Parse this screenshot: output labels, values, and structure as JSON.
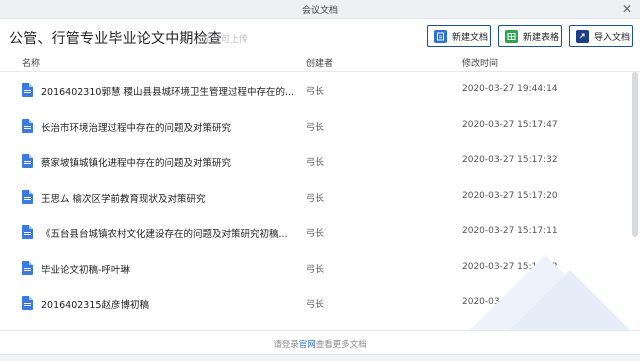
{
  "window": {
    "title": "会议文档",
    "close_glyph": "✕"
  },
  "header": {
    "title": "公管、行管专业毕业论文中期检查",
    "upload_hint": "全员可上传",
    "buttons": {
      "new_doc": "新建文档",
      "new_sheet": "新建表格",
      "import_doc": "导入文档"
    }
  },
  "columns": {
    "name": "名称",
    "creator": "创建者",
    "modified": "修改时间"
  },
  "files": [
    {
      "name": "2016402310郭慧 稷山县县城环境卫生管理过程中存在的...",
      "creator": "弓长",
      "modified": "2020-03-27 19:44:14",
      "icon": "doc-icon"
    },
    {
      "name": "长治市环境治理过程中存在的问题及对策研究",
      "creator": "弓长",
      "modified": "2020-03-27 15:17:47",
      "icon": "doc-icon"
    },
    {
      "name": "蔡家坡镇城镇化进程中存在的问题及对策研究",
      "creator": "弓长",
      "modified": "2020-03-27 15:17:32",
      "icon": "doc-icon"
    },
    {
      "name": "王思ム 榆次区学前教育现状及对策研究",
      "creator": "弓长",
      "modified": "2020-03-27 15:17:20",
      "icon": "doc-icon"
    },
    {
      "name": "《五台县台城镇农村文化建设存在的问题及对策研究初稿...",
      "creator": "弓长",
      "modified": "2020-03-27 15:17:11",
      "icon": "doc-icon"
    },
    {
      "name": "毕业论文初稿-呼叶琳",
      "creator": "弓长",
      "modified": "2020-03-27 15:16:52",
      "icon": "doc-icon"
    },
    {
      "name": "2016402315赵彦博初稿",
      "creator": "弓长",
      "modified": "2020-03-27 15:16:43",
      "icon": "doc-icon"
    }
  ],
  "footer": {
    "prefix": "请登录",
    "link": "官网",
    "suffix": "查看更多文档"
  },
  "colors": {
    "accent": "#2f6fd6",
    "sheet_green": "#2ea44f",
    "button_border": "#1a4fa3"
  }
}
